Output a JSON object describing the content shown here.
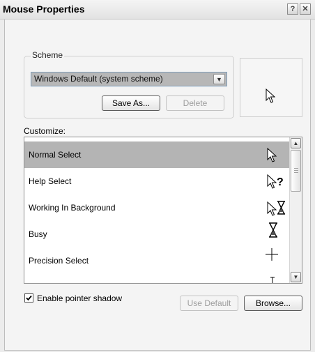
{
  "window": {
    "title": "Mouse Properties",
    "help_glyph": "?",
    "close_glyph": "✕"
  },
  "scheme": {
    "legend": "Scheme",
    "selected": "Windows Default (system scheme)",
    "dropdown_glyph": "▼",
    "save_as_label": "Save As...",
    "delete_label": "Delete"
  },
  "customize": {
    "label": "Customize:",
    "items": [
      {
        "label": "Normal Select",
        "icon": "arrow-cursor-icon",
        "selected": true
      },
      {
        "label": "Help Select",
        "icon": "help-cursor-icon",
        "selected": false
      },
      {
        "label": "Working In Background",
        "icon": "working-cursor-icon",
        "selected": false
      },
      {
        "label": "Busy",
        "icon": "hourglass-icon",
        "selected": false
      },
      {
        "label": "Precision Select",
        "icon": "crosshair-icon",
        "selected": false
      }
    ],
    "scroll_up_glyph": "▲",
    "scroll_down_glyph": "▼"
  },
  "options": {
    "shadow_label": "Enable pointer shadow",
    "shadow_checked": true,
    "use_default_label": "Use Default",
    "browse_label": "Browse..."
  }
}
